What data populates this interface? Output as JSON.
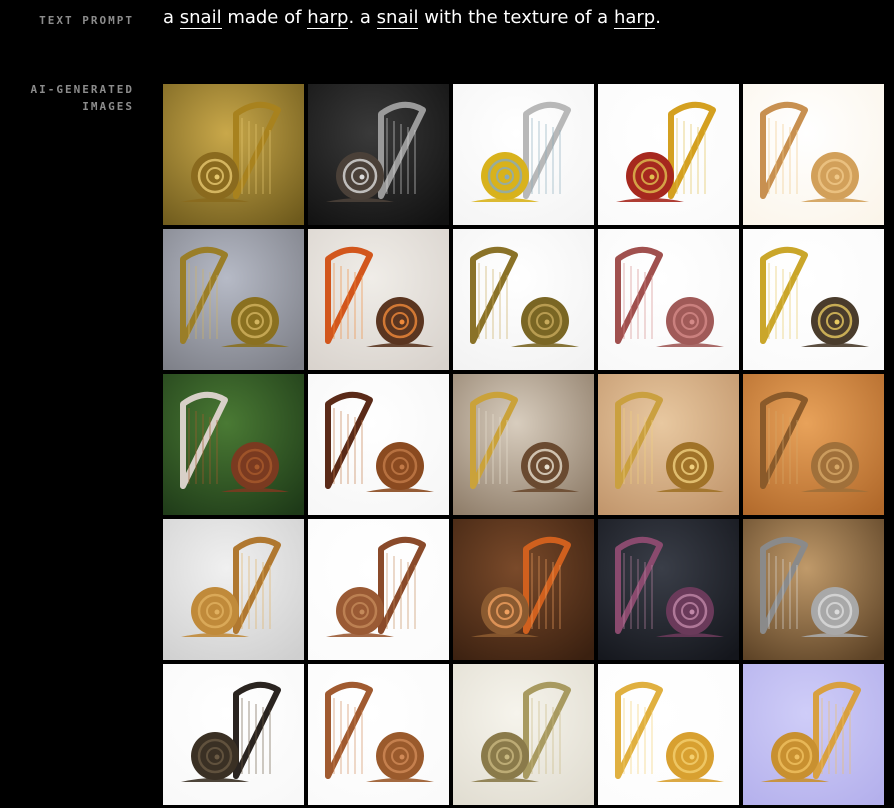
{
  "labels": {
    "text_prompt": "TEXT PROMPT",
    "ai_generated_line1": "AI-GENERATED",
    "ai_generated_line2": "IMAGES"
  },
  "prompt": {
    "parts": [
      "a ",
      "snail",
      " made of ",
      "harp",
      ". a ",
      "snail",
      " with the texture of a ",
      "harp",
      "."
    ]
  },
  "images": [
    {
      "bg1": "#c9a84a",
      "bg2": "#6e5a1c",
      "snail": "#8a6a1e",
      "harp": "#a8821e",
      "accent": "#e6c870",
      "snail_side": "left"
    },
    {
      "bg1": "#3a3a3a",
      "bg2": "#111111",
      "snail": "#4a4038",
      "harp": "#9a9a9a",
      "accent": "#dcdcdc",
      "snail_side": "left"
    },
    {
      "bg1": "#ffffff",
      "bg2": "#f4f4f4",
      "snail": "#d8b21c",
      "harp": "#b8b8b8",
      "accent": "#88aabb",
      "snail_side": "left"
    },
    {
      "bg1": "#ffffff",
      "bg2": "#fafafa",
      "snail": "#a6281e",
      "harp": "#d4a020",
      "accent": "#e0c050",
      "snail_side": "left"
    },
    {
      "bg1": "#ffffff",
      "bg2": "#fbf5ea",
      "snail": "#d2a05a",
      "harp": "#c89050",
      "accent": "#f0c888",
      "snail_side": "right"
    },
    {
      "bg1": "#b6bac6",
      "bg2": "#7c7e86",
      "snail": "#8a7020",
      "harp": "#9a7e28",
      "accent": "#d2b460",
      "snail_side": "right"
    },
    {
      "bg1": "#f0ede8",
      "bg2": "#d8d2cc",
      "snail": "#5a3520",
      "harp": "#d2561c",
      "accent": "#f08a3a",
      "snail_side": "right"
    },
    {
      "bg1": "#ffffff",
      "bg2": "#f2f2f2",
      "snail": "#7a6624",
      "harp": "#8a7228",
      "accent": "#c8aa5c",
      "snail_side": "right"
    },
    {
      "bg1": "#ffffff",
      "bg2": "#f8f8f8",
      "snail": "#a05a58",
      "harp": "#a0504e",
      "accent": "#d48a88",
      "snail_side": "right"
    },
    {
      "bg1": "#ffffff",
      "bg2": "#fafafa",
      "snail": "#4a3c2c",
      "harp": "#caa62a",
      "accent": "#e6c860",
      "snail_side": "right"
    },
    {
      "bg1": "#4a7a34",
      "bg2": "#1e3a18",
      "snail": "#7a3a20",
      "harp": "#d8d0c8",
      "accent": "#a85a2c",
      "snail_side": "right"
    },
    {
      "bg1": "#ffffff",
      "bg2": "#f6f6f6",
      "snail": "#8a4a20",
      "harp": "#5a2a18",
      "accent": "#c27a48",
      "snail_side": "right"
    },
    {
      "bg1": "#d8cdbe",
      "bg2": "#8c7a66",
      "snail": "#6a4a30",
      "harp": "#caa23a",
      "accent": "#e8e0d0",
      "snail_side": "right"
    },
    {
      "bg1": "#e8c8a0",
      "bg2": "#c0946a",
      "snail": "#a07228",
      "harp": "#caa040",
      "accent": "#f0d080",
      "snail_side": "right"
    },
    {
      "bg1": "#e8a25a",
      "bg2": "#b0682a",
      "snail": "#a0703a",
      "harp": "#8a5a2a",
      "accent": "#d6a868",
      "snail_side": "right"
    },
    {
      "bg1": "#f0f0f0",
      "bg2": "#cfcfcf",
      "snail": "#c08a3a",
      "harp": "#b07830",
      "accent": "#e0b060",
      "snail_side": "left"
    },
    {
      "bg1": "#ffffff",
      "bg2": "#fbfbfb",
      "snail": "#9a5a34",
      "harp": "#8a4a2a",
      "accent": "#c48a5a",
      "snail_side": "left"
    },
    {
      "bg1": "#7a4a2a",
      "bg2": "#3a2010",
      "snail": "#8a5a30",
      "harp": "#d0601e",
      "accent": "#f0a060",
      "snail_side": "left"
    },
    {
      "bg1": "#3a3e48",
      "bg2": "#14161c",
      "snail": "#6a3a5a",
      "harp": "#8a4a6e",
      "accent": "#c088a8",
      "snail_side": "right"
    },
    {
      "bg1": "#c09a6a",
      "bg2": "#5a4024",
      "snail": "#a8a8a8",
      "harp": "#8a8a8a",
      "accent": "#dcdcdc",
      "snail_side": "right"
    },
    {
      "bg1": "#ffffff",
      "bg2": "#f8f8f8",
      "snail": "#3a3024",
      "harp": "#2a2420",
      "accent": "#6a5a44",
      "snail_side": "left"
    },
    {
      "bg1": "#ffffff",
      "bg2": "#fafafa",
      "snail": "#9a5a2c",
      "harp": "#a05a30",
      "accent": "#d08a58",
      "snail_side": "right"
    },
    {
      "bg1": "#f6f4ec",
      "bg2": "#e0dcd0",
      "snail": "#8a7a4a",
      "harp": "#a89a60",
      "accent": "#c8b880",
      "snail_side": "left"
    },
    {
      "bg1": "#ffffff",
      "bg2": "#fcfcfc",
      "snail": "#d8a030",
      "harp": "#e0b040",
      "accent": "#f4d070",
      "snail_side": "right"
    },
    {
      "bg1": "#cfcdf8",
      "bg2": "#b4b0ec",
      "snail": "#c89030",
      "harp": "#d8a040",
      "accent": "#f0c060",
      "snail_side": "left"
    }
  ]
}
